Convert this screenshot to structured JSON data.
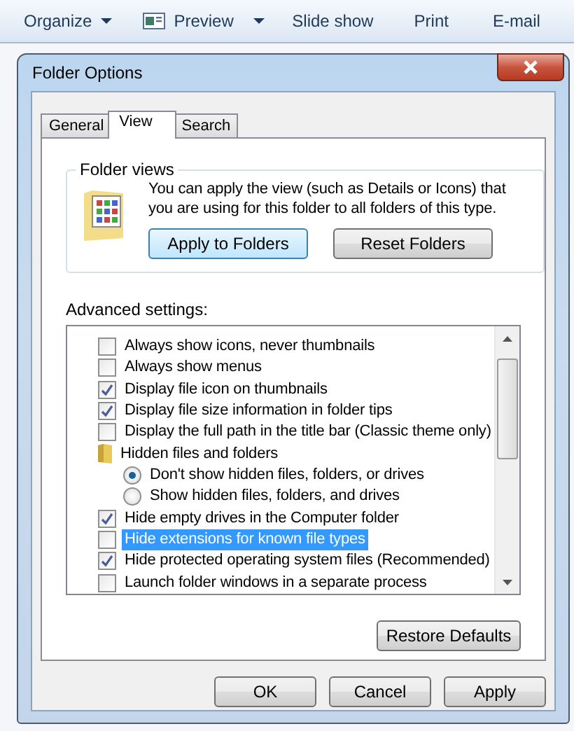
{
  "toolbar": {
    "items": [
      {
        "kind": "menu",
        "label": "Organize"
      },
      {
        "kind": "preview",
        "label": "Preview"
      },
      {
        "kind": "plain",
        "label": "Slide show"
      },
      {
        "kind": "plain",
        "label": "Print"
      },
      {
        "kind": "plain",
        "label": "E-mail"
      }
    ]
  },
  "dialog": {
    "title": "Folder Options",
    "tabs": [
      {
        "label": "General",
        "selected": false
      },
      {
        "label": "View",
        "selected": true
      },
      {
        "label": "Search",
        "selected": false
      }
    ],
    "folder_views": {
      "title": "Folder views",
      "description": "You can apply the view (such as Details or Icons) that you are using for this folder to all folders of this type.",
      "buttons": [
        {
          "label": "Apply to Folders",
          "focused": true
        },
        {
          "label": "Reset Folders",
          "focused": false
        }
      ]
    },
    "advanced": {
      "label": "Advanced settings:",
      "items": [
        {
          "kind": "checkbox",
          "label": "Always show icons, never thumbnails",
          "checked": false,
          "selected": false
        },
        {
          "kind": "checkbox",
          "label": "Always show menus",
          "checked": false,
          "selected": false
        },
        {
          "kind": "checkbox",
          "label": "Display file icon on thumbnails",
          "checked": true,
          "selected": false
        },
        {
          "kind": "checkbox",
          "label": "Display file size information in folder tips",
          "checked": true,
          "selected": false
        },
        {
          "kind": "checkbox",
          "label": "Display the full path in the title bar (Classic theme only)",
          "checked": false,
          "selected": false
        },
        {
          "kind": "group",
          "label": "Hidden files and folders",
          "selected": false,
          "children": [
            {
              "kind": "radio",
              "label": "Don't show hidden files, folders, or drives",
              "checked": true,
              "selected": false
            },
            {
              "kind": "radio",
              "label": "Show hidden files, folders, and drives",
              "checked": false,
              "selected": false
            }
          ]
        },
        {
          "kind": "checkbox",
          "label": "Hide empty drives in the Computer folder",
          "checked": true,
          "selected": false
        },
        {
          "kind": "checkbox",
          "label": "Hide extensions for known file types",
          "checked": false,
          "selected": true
        },
        {
          "kind": "checkbox",
          "label": "Hide protected operating system files (Recommended)",
          "checked": true,
          "selected": false
        },
        {
          "kind": "checkbox",
          "label": "Launch folder windows in a separate process",
          "checked": false,
          "selected": false
        }
      ],
      "restore_button": "Restore Defaults"
    },
    "buttons": [
      "OK",
      "Cancel",
      "Apply"
    ]
  }
}
